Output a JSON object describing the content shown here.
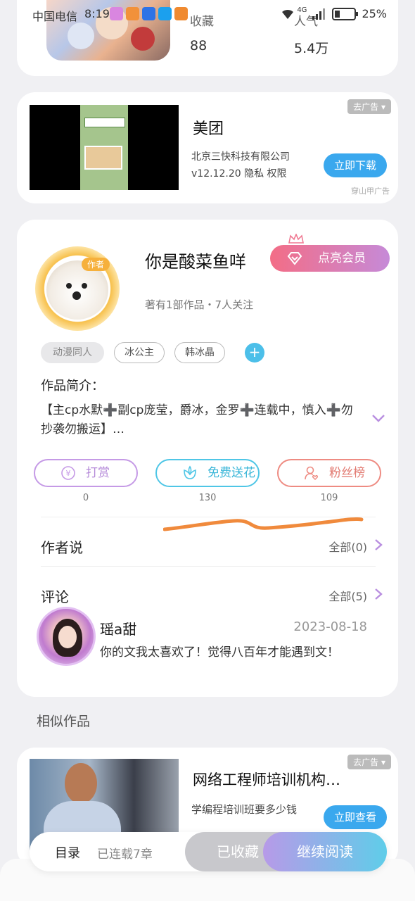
{
  "status_bar": {
    "carrier": "中国电信",
    "time": "8:19",
    "network": "4G",
    "battery": "25%"
  },
  "top_book": {
    "stats": [
      {
        "label": "收藏",
        "value": "88"
      },
      {
        "label": "人气",
        "value": "5.4万"
      }
    ]
  },
  "ad1": {
    "badge": "去广告",
    "title": "美团",
    "company": "北京三快科技有限公司",
    "meta": "v12.12.20 隐私 权限",
    "button": "立即下载",
    "source": "穿山甲广告"
  },
  "author": {
    "avatar_tag": "作者",
    "name": "你是酸菜鱼咩",
    "meta": "著有1部作品・7人关注",
    "vip_button": "点亮会员",
    "tags": [
      "动漫同人",
      "冰公主",
      "韩冰晶"
    ],
    "add_tag": "+",
    "intro_label": "作品简介：",
    "intro_text": "【主cp水默➕副cp庞莹，爵冰，金罗➕连载中，慎入➕勿抄袭勿搬运】…"
  },
  "actions": [
    {
      "label": "打赏",
      "count": "0",
      "color": "#c59ae6"
    },
    {
      "label": "免费送花",
      "count": "130",
      "color": "#4fc6e6"
    },
    {
      "label": "粉丝榜",
      "count": "109",
      "color": "#ee8b82"
    }
  ],
  "author_says": {
    "title": "作者说",
    "link": "全部(0)"
  },
  "comments": {
    "title": "评论",
    "link": "全部(5)",
    "items": [
      {
        "user": "瑶a甜",
        "date": "2023-08-18",
        "text": "你的文我太喜欢了！觉得八百年才能遇到文！"
      }
    ]
  },
  "similar": {
    "title": "相似作品"
  },
  "ad2": {
    "badge": "去广告",
    "title": "网络工程师培训机构…",
    "sub": "学编程培训班要多少钱",
    "button": "立即查看"
  },
  "bottom": {
    "toc": "目录",
    "toc_count": "已连载7章",
    "fav": "已收藏",
    "read": "继续阅读"
  }
}
